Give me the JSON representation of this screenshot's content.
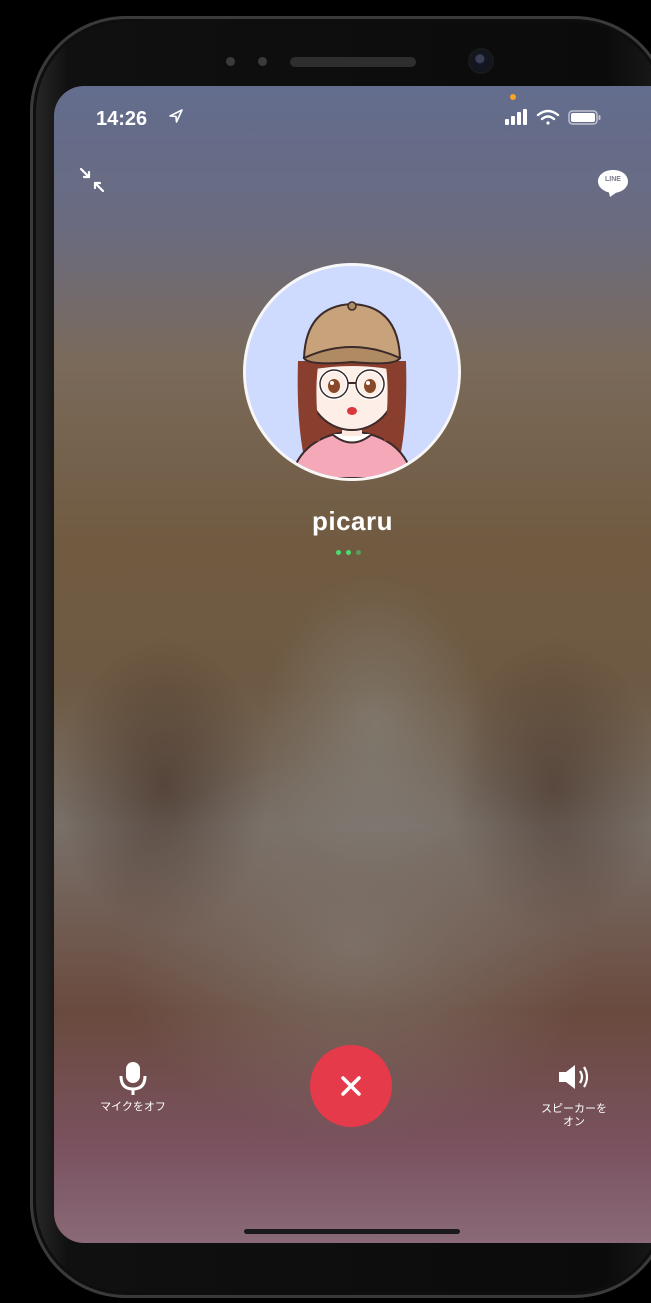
{
  "status_bar": {
    "time": "14:26",
    "location_icon": "location-arrow-icon",
    "signal_icon": "cellular-signal-icon",
    "wifi_icon": "wifi-icon",
    "battery_icon": "battery-icon",
    "privacy_indicator_color": "#f5a623"
  },
  "top_controls": {
    "minimize_icon": "collapse-arrows-icon",
    "app_icon": "line-logo-icon",
    "app_icon_text": "LINE"
  },
  "caller": {
    "name": "picaru",
    "avatar_icon": "profile-avatar",
    "calling_indicator_color": "#4bdc72"
  },
  "controls": {
    "mute": {
      "icon": "microphone-icon",
      "label": "マイクをオフ"
    },
    "end_call": {
      "icon": "close-icon",
      "color": "#e53a4a"
    },
    "speaker": {
      "icon": "speaker-icon",
      "label_line1": "スピーカーを",
      "label_line2": "オン"
    }
  }
}
